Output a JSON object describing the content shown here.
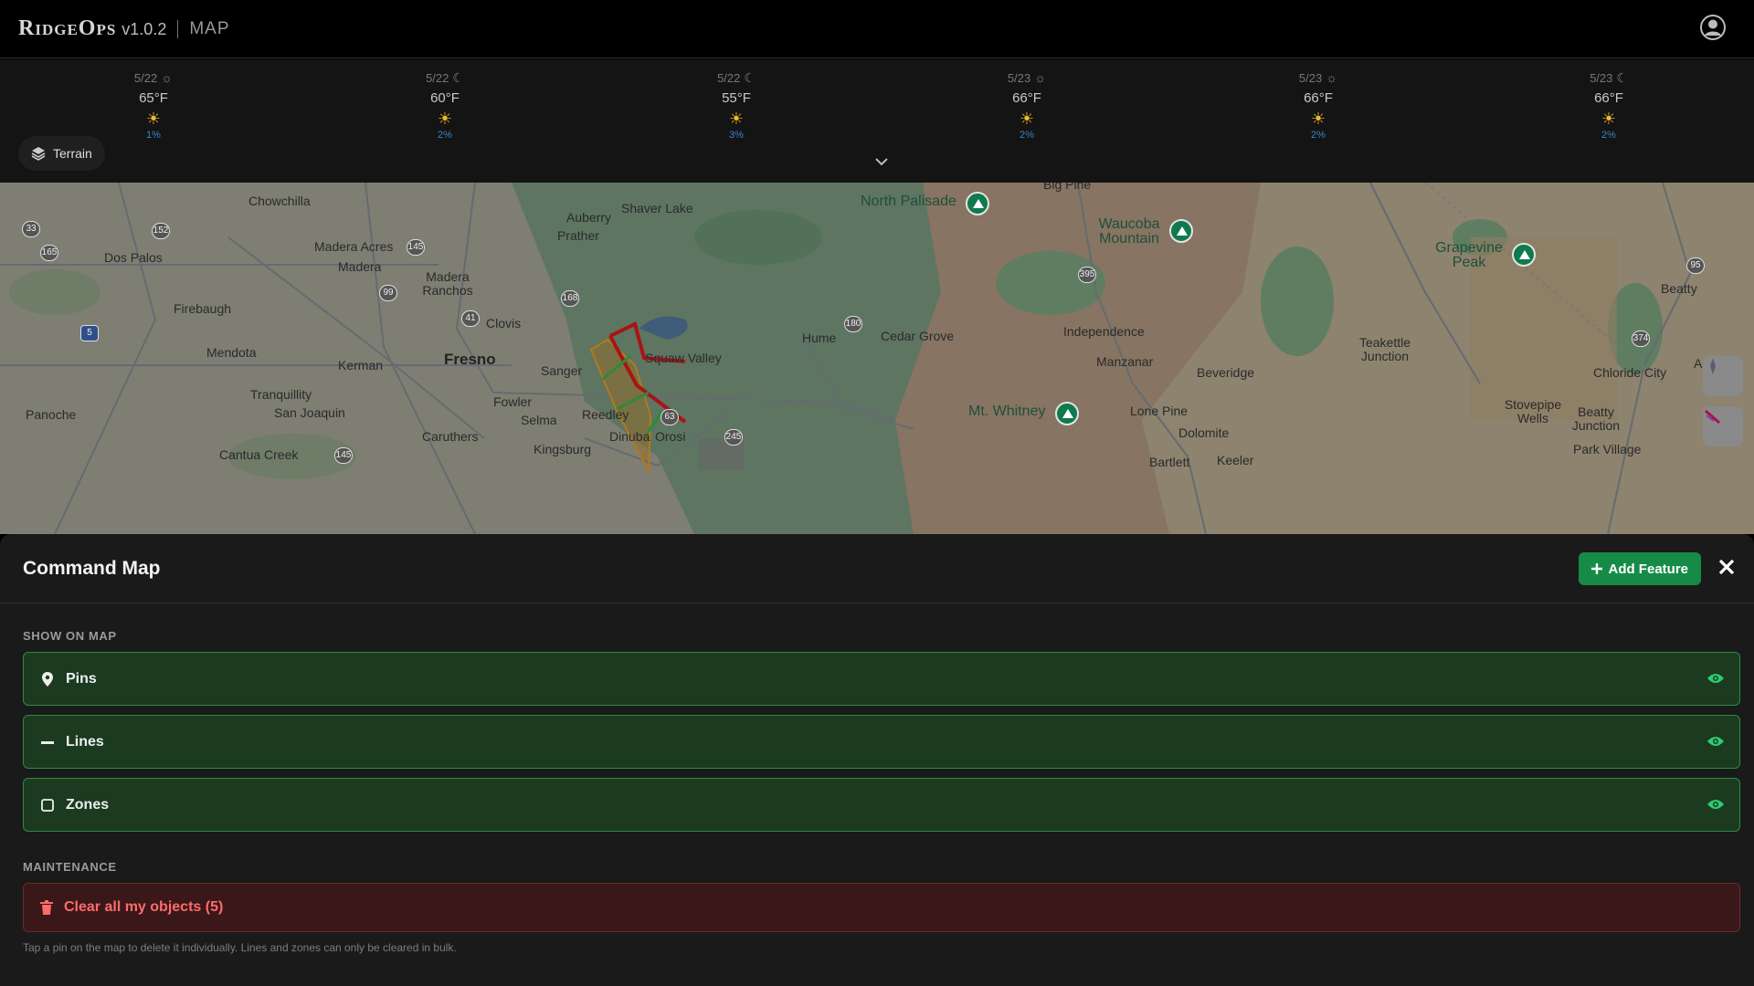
{
  "header": {
    "brand": "RidgeOps",
    "version": "v1.0.2",
    "section": "MAP",
    "avatar_icon": "user-circle-icon"
  },
  "weather": {
    "slots": [
      {
        "date": "5/22",
        "period_icon": "sun-icon",
        "temp": "65°F",
        "condition_icon": "sun-icon",
        "precip": "1%"
      },
      {
        "date": "5/22",
        "period_icon": "moon-icon",
        "temp": "60°F",
        "condition_icon": "sun-icon",
        "precip": "2%"
      },
      {
        "date": "5/22",
        "period_icon": "moon-icon",
        "temp": "55°F",
        "condition_icon": "sun-icon",
        "precip": "3%"
      },
      {
        "date": "5/23",
        "period_icon": "sun-icon",
        "temp": "66°F",
        "condition_icon": "sun-icon",
        "precip": "2%"
      },
      {
        "date": "5/23",
        "period_icon": "sun-icon",
        "temp": "66°F",
        "condition_icon": "sun-icon",
        "precip": "2%"
      },
      {
        "date": "5/23",
        "period_icon": "moon-icon",
        "temp": "66°F",
        "condition_icon": "sun-icon",
        "precip": "2%"
      }
    ],
    "terrain_label": "Terrain"
  },
  "map": {
    "places": [
      "Chowchilla",
      "Dos Palos",
      "Madera Acres",
      "Madera",
      "Madera Ranchos",
      "Firebaugh",
      "Mendota",
      "Kerman",
      "Fresno",
      "Clovis",
      "Tranquillity",
      "San Joaquin",
      "Panoche",
      "Cantua Creek",
      "Caruthers",
      "Fowler",
      "Selma",
      "Kingsburg",
      "Reedley",
      "Dinuba",
      "Orosi",
      "Sanger",
      "Prather",
      "Auberry",
      "Shaver Lake",
      "Hume",
      "Cedar Grove",
      "Independence",
      "Manzanar",
      "Lone Pine",
      "Dolomite",
      "Bartlett",
      "Keeler",
      "Beveridge",
      "Teakettle Junction",
      "Chloride City",
      "Stovepipe Wells",
      "Beatty Junction",
      "Park Village",
      "Beatty",
      "Ashton",
      "Big Pine",
      "Squaw Valley"
    ],
    "peaks": [
      "North Palisade",
      "Waucoba Mountain",
      "Grapevine Peak",
      "Mt. Whitney"
    ],
    "routes": [
      "33",
      "152",
      "165",
      "5",
      "145",
      "99",
      "41",
      "168",
      "180",
      "395",
      "95",
      "374",
      "63",
      "245",
      "145"
    ]
  },
  "panel": {
    "title": "Command Map",
    "add_label": "Add Feature",
    "show_label": "SHOW ON MAP",
    "layers": [
      {
        "label": "Pins",
        "icon": "map-pin-icon"
      },
      {
        "label": "Lines",
        "icon": "minus-icon"
      },
      {
        "label": "Zones",
        "icon": "square-icon"
      }
    ],
    "maintenance_label": "MAINTENANCE",
    "clear_label": "Clear all my objects (5)",
    "hint": "Tap a pin on the map to delete it individually. Lines and zones can only be cleared in bulk."
  }
}
